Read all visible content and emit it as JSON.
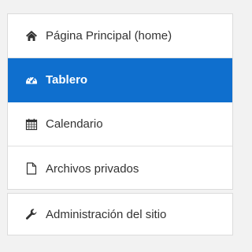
{
  "nav": {
    "items": [
      {
        "label": "Página Principal (home)",
        "icon": "home-icon",
        "active": false
      },
      {
        "label": "Tablero",
        "icon": "dashboard-icon",
        "active": true
      },
      {
        "label": "Calendario",
        "icon": "calendar-icon",
        "active": false
      },
      {
        "label": "Archivos privados",
        "icon": "file-icon",
        "active": false
      }
    ],
    "admin": {
      "label": "Administración del sitio",
      "icon": "wrench-icon"
    }
  },
  "colors": {
    "active_background": "#0f6fce",
    "active_text": "#ffffff",
    "text": "#333333",
    "page_background": "#f2f2f2"
  }
}
